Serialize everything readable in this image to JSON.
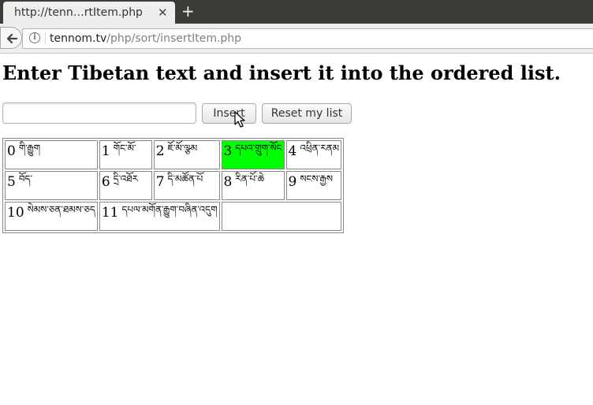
{
  "browser": {
    "tab_title": "http://tenn…rtItem.php",
    "tab_close": "✕",
    "new_tab": "+",
    "url_host": "tennom.tv",
    "url_path": "/php/sort/insertItem.php"
  },
  "page": {
    "title": "Enter Tibetan text and insert it into the ordered list.",
    "input_value": "",
    "insert_label": "Insert",
    "reset_label": "Reset my list"
  },
  "list": {
    "highlight_color": "#00ff00",
    "items": [
      {
        "index": "0",
        "text": "གི་རྒྱུག"
      },
      {
        "index": "1",
        "text": "གོང་མོ་"
      },
      {
        "index": "2",
        "text": "ཇོ་མོ་ལྩམ"
      },
      {
        "index": "3",
        "text": "དཔའ་གྲུག་སོང"
      },
      {
        "index": "4",
        "text": "འཕྲིན་རནམ"
      },
      {
        "index": "5",
        "text": "བོད་"
      },
      {
        "index": "6",
        "text": "དྲི་འཐོར"
      },
      {
        "index": "7",
        "text": "དི་མཚོན་པོ"
      },
      {
        "index": "8",
        "text": "རིན་པོ་ཆེ"
      },
      {
        "index": "9",
        "text": "སངས་རྒྱས"
      },
      {
        "index": "10",
        "text": "སེམས་ཅན་ཐམས་ཅད"
      },
      {
        "index": "11",
        "text": "དཔལ་མགོན་རྒྱུག་བཞིན་འདུག"
      }
    ]
  }
}
